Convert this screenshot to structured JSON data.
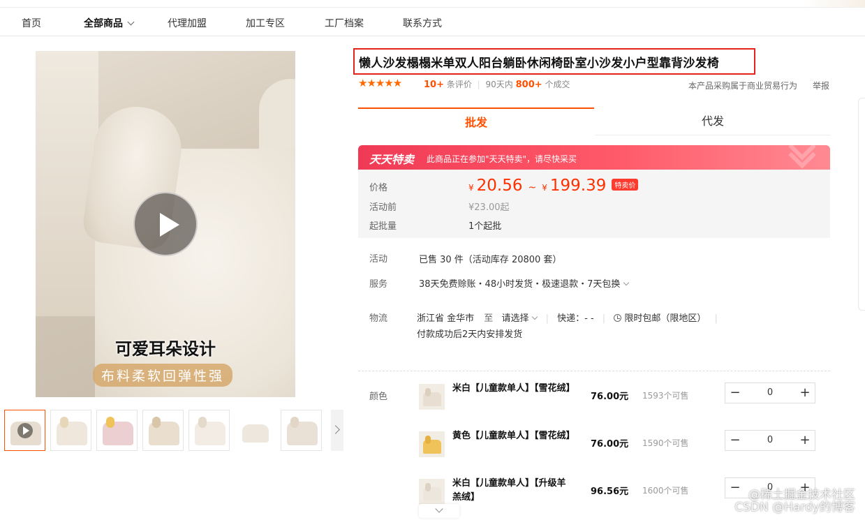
{
  "nav": {
    "items": [
      "首页",
      "全部商品",
      "代理加盟",
      "加工专区",
      "工厂档案",
      "联系方式"
    ]
  },
  "gallery": {
    "caption_main": "可爱耳朵设计",
    "caption_sub": "布料柔软回弹性强",
    "thumb_colors": [
      "#efe7dc",
      "#e8d9c6",
      "#eccfd0",
      "#eadfcf",
      "#f2ece4",
      "#f6f3ee",
      "#e9e1d6"
    ]
  },
  "product": {
    "title": "懒人沙发榻榻米单双人阳台躺卧休闲椅卧室小沙发小户型靠背沙发椅",
    "stars": "★★★★★",
    "review_count": "10+",
    "review_label": "条评价",
    "days_label": "90天内",
    "sales_count": "800+",
    "sales_label": "个成交",
    "biz_note": "本产品采购属于商业贸易行为",
    "report": "举报"
  },
  "tabs": {
    "wholesale": "批发",
    "dropship": "代发"
  },
  "promo": {
    "logo": "天天特卖",
    "text": "此商品正在参加\"天天特卖\"，请尽快采买"
  },
  "price": {
    "label": "价格",
    "currency": "¥",
    "low": "20.56",
    "tilde": "~",
    "high": "199.39",
    "special_tag": "特卖价",
    "before_label": "活动前",
    "before_value": "¥23.00起",
    "moq_label": "起批量",
    "moq_value": "1个起批"
  },
  "activity": {
    "label": "活动",
    "value": "已售 30 件（活动库存 20800 套）"
  },
  "service": {
    "label": "服务",
    "value": "38天免费赊账・48小时发货・极速退款・7天包换"
  },
  "logistics": {
    "label": "物流",
    "origin": "浙江省 金华市",
    "to": "至",
    "select": "请选择",
    "express": "快递：- -",
    "free_ship": "限时包邮（限地区）",
    "note": "付款成功后2天内安排发货"
  },
  "sku": {
    "label": "颜色",
    "items": [
      {
        "name": "米白【儿童款单人】【雪花绒】",
        "price": "76.00元",
        "stock": "1593个可售",
        "qty": "0",
        "color": "#e8dfd2",
        "tone": "#dccfbd"
      },
      {
        "name": "黄色【儿童款单人】【雪花绒】",
        "price": "76.00元",
        "stock": "1590个可售",
        "qty": "0",
        "color": "#f0c35a",
        "tone": "#e6b040"
      },
      {
        "name": "米白【儿童款单人】【升级羊羔绒】",
        "price": "96.56元",
        "stock": "1600个可售",
        "qty": "0",
        "color": "#ede6dc",
        "tone": "#ddd2c3"
      }
    ],
    "minus": "−",
    "plus": "+"
  },
  "watermark": {
    "line1": "@稀土掘金技术社区",
    "line2": "CSDN @Hardy的博客"
  }
}
